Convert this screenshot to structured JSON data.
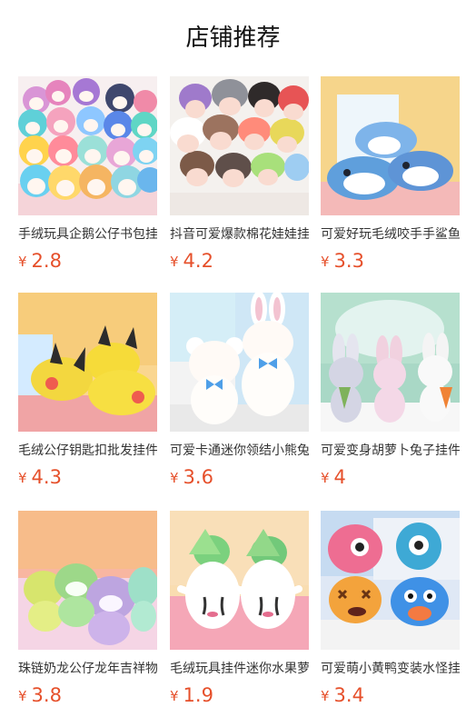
{
  "page": {
    "title": "店铺推荐",
    "currency_symbol": "¥",
    "price_color": "#e6502b"
  },
  "products": [
    {
      "name": "手绒玩具企鹅公仔书包挂件",
      "price": "2.8",
      "image": "penguin-plush-photo"
    },
    {
      "name": "抖音可爱爆款棉花娃娃挂件",
      "price": "4.2",
      "image": "doll-plush-photo"
    },
    {
      "name": "可爱好玩毛绒咬手手鲨鱼",
      "price": "3.3",
      "image": "shark-plush-photo"
    },
    {
      "name": "毛绒公仔钥匙扣批发挂件",
      "price": "4.3",
      "image": "yellow-plush-photo"
    },
    {
      "name": "可爱卡通迷你领结小熊兔",
      "price": "3.6",
      "image": "bear-bunny-plush-photo"
    },
    {
      "name": "可爱变身胡萝卜兔子挂件",
      "price": "4",
      "image": "bunny-plush-photo"
    },
    {
      "name": "珠链奶龙公仔龙年吉祥物",
      "price": "3.8",
      "image": "dragon-plush-photo"
    },
    {
      "name": "毛绒玩具挂件迷你水果萝卜",
      "price": "1.9",
      "image": "radish-plush-photo"
    },
    {
      "name": "可爱萌小黄鸭变装水怪挂件",
      "price": "3.4",
      "image": "monster-plush-photo"
    }
  ]
}
